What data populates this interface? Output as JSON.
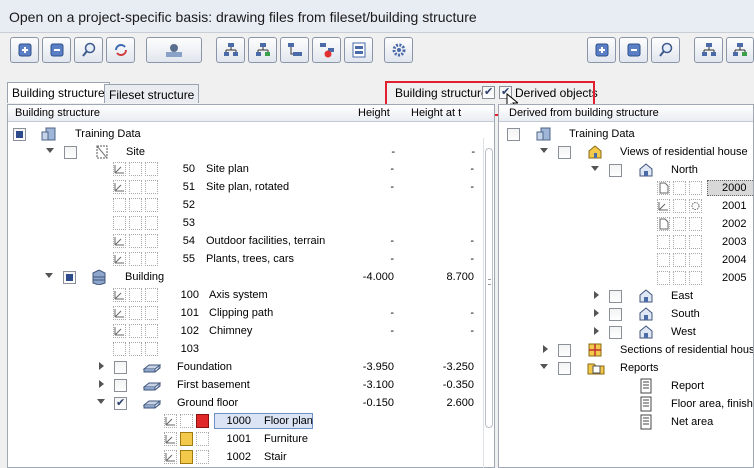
{
  "window": {
    "title": "Open on a project-specific basis: drawing files from fileset/building structure"
  },
  "toolbar": {
    "left_buttons": [
      "expand-all-icon",
      "collapse-all-icon",
      "find-icon",
      "refresh-icon",
      "user-settings-icon",
      "structure-a-icon",
      "structure-b-icon",
      "structure-c-icon",
      "structure-d-icon",
      "structure-e-icon",
      "gear-icon"
    ],
    "right_buttons": [
      "expand-all-icon",
      "collapse-all-icon",
      "find-icon",
      "structure-a-icon",
      "structure-b-icon"
    ]
  },
  "tabs": [
    "Building structure",
    "Fileset structure"
  ],
  "options": {
    "building_structure": "Building structure",
    "derived_objects": "Derived objects"
  },
  "left_panel": {
    "headers": {
      "name": "Building structure",
      "height": "Height",
      "height_at": "Height at t"
    },
    "rows": [
      {
        "label": "Training Data",
        "num": "",
        "h1": "",
        "h2": ""
      },
      {
        "label": "Site",
        "num": "",
        "h1": "-",
        "h2": "-"
      },
      {
        "label": "Site plan",
        "num": "50",
        "h1": "-",
        "h2": "-"
      },
      {
        "label": "Site plan, rotated",
        "num": "51",
        "h1": "-",
        "h2": "-"
      },
      {
        "label": "",
        "num": "52",
        "h1": "",
        "h2": ""
      },
      {
        "label": "",
        "num": "53",
        "h1": "",
        "h2": ""
      },
      {
        "label": "Outdoor facilities, terrain",
        "num": "54",
        "h1": "-",
        "h2": "-"
      },
      {
        "label": "Plants, trees, cars",
        "num": "55",
        "h1": "-",
        "h2": "-"
      },
      {
        "label": "Building",
        "num": "",
        "h1": "-4.000",
        "h2": "8.700"
      },
      {
        "label": "Axis system",
        "num": "100",
        "h1": "",
        "h2": ""
      },
      {
        "label": "Clipping path",
        "num": "101",
        "h1": "-",
        "h2": "-"
      },
      {
        "label": "Chimney",
        "num": "102",
        "h1": "-",
        "h2": "-"
      },
      {
        "label": "",
        "num": "103",
        "h1": "",
        "h2": ""
      },
      {
        "label": "Foundation",
        "num": "",
        "h1": "-3.950",
        "h2": "-3.250"
      },
      {
        "label": "First basement",
        "num": "",
        "h1": "-3.100",
        "h2": "-0.350"
      },
      {
        "label": "Ground floor",
        "num": "",
        "h1": "-0.150",
        "h2": "2.600"
      },
      {
        "label": "Floor plan",
        "num": "1000",
        "h1": "",
        "h2": ""
      },
      {
        "label": "Furniture",
        "num": "1001",
        "h1": "",
        "h2": ""
      },
      {
        "label": "Stair",
        "num": "1002",
        "h1": "",
        "h2": ""
      }
    ]
  },
  "right_panel": {
    "header": "Derived from building structure",
    "rows": [
      {
        "label": "Training Data"
      },
      {
        "label": "Views of residential house"
      },
      {
        "label": "North"
      },
      {
        "label": "2000"
      },
      {
        "label": "2001"
      },
      {
        "label": "2002"
      },
      {
        "label": "2003"
      },
      {
        "label": "2004"
      },
      {
        "label": "2005"
      },
      {
        "label": "East"
      },
      {
        "label": "South"
      },
      {
        "label": "West"
      },
      {
        "label": "Sections of residential house"
      },
      {
        "label": "Reports"
      },
      {
        "label": "Report"
      },
      {
        "label": "Floor area, finished"
      },
      {
        "label": "Net area"
      }
    ]
  },
  "colors": {
    "highlight": "#e0202e",
    "selection": "#dbe4f5",
    "folder": "#f3c94b",
    "red_marker": "#e02828"
  }
}
